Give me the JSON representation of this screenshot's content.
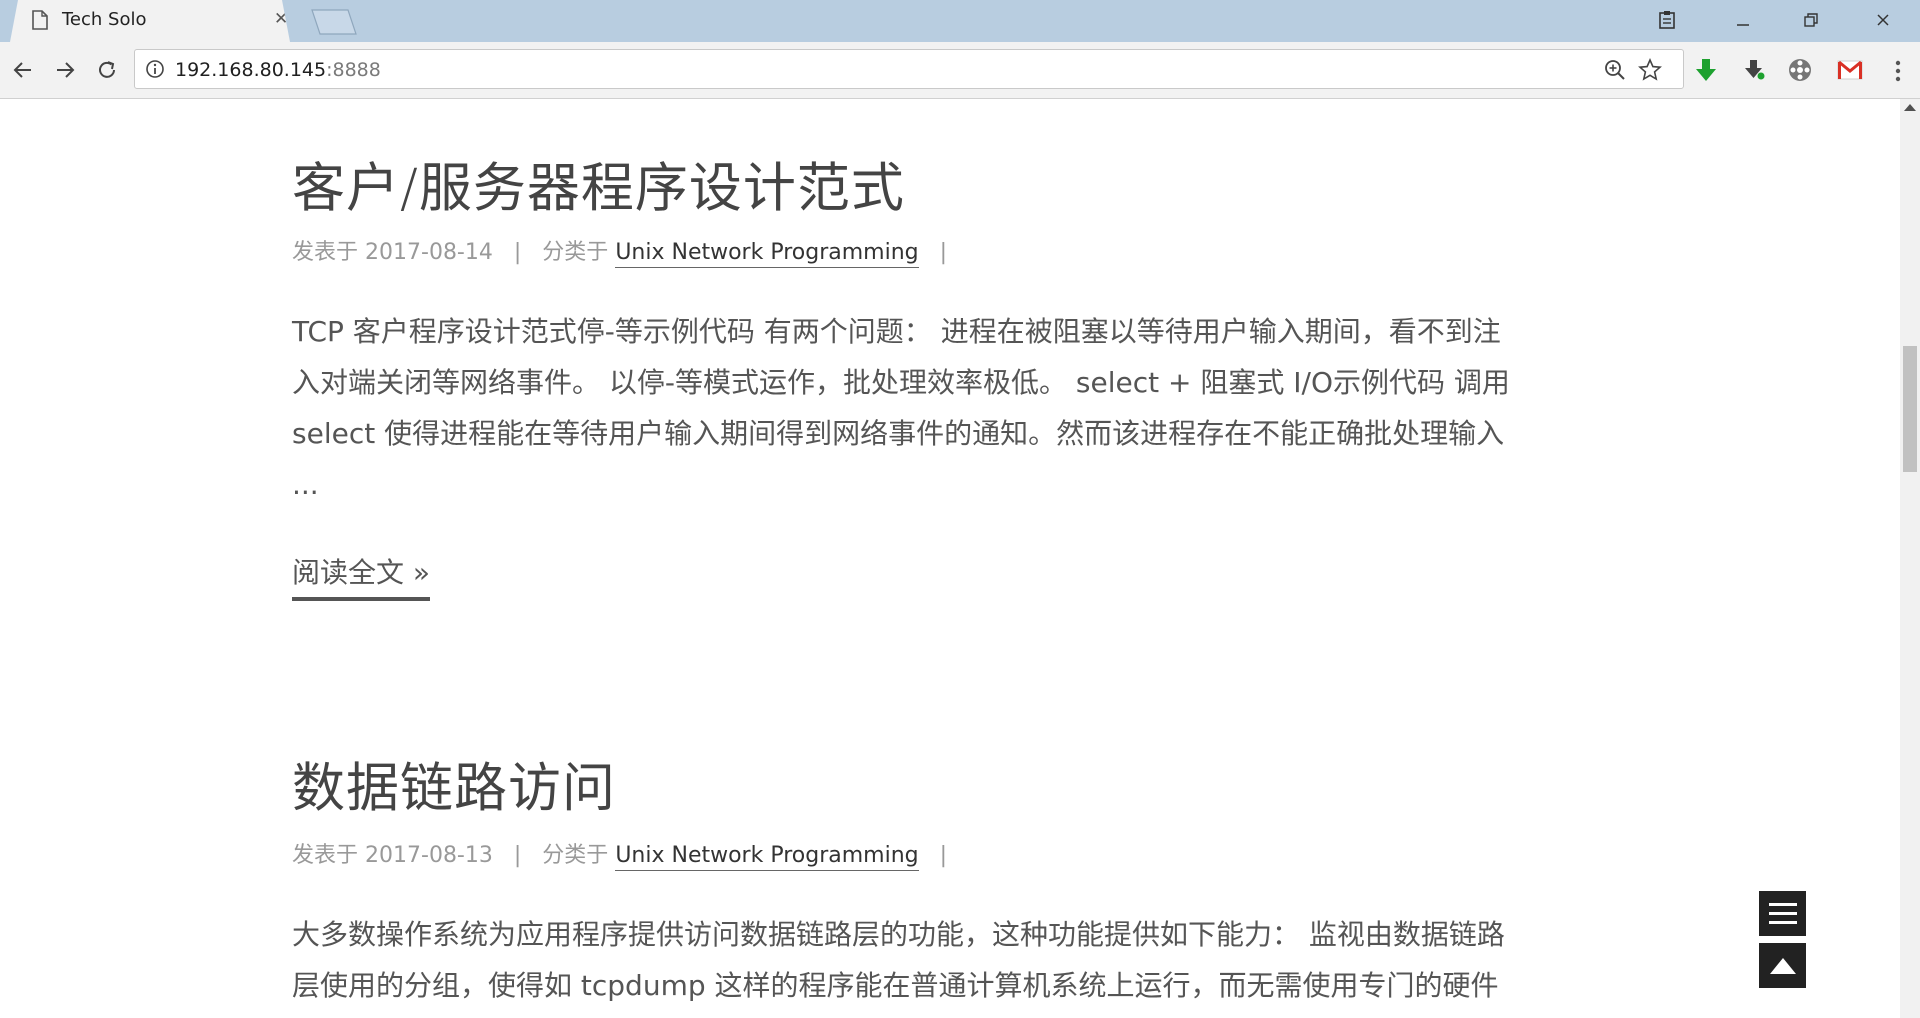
{
  "browser": {
    "tab_title": "Tech Solo",
    "url_host": "192.168.80.145",
    "url_port": ":8888"
  },
  "posts": [
    {
      "title": "客户/服务器程序设计范式",
      "date_prefix": "发表于",
      "date": "2017-08-14",
      "category_prefix": "分类于",
      "category": "Unix Network Programming",
      "excerpt_lines": [
        "TCP 客户程序设计范式停-等示例代码 有两个问题： 进程在被阻塞以等待用户输入期间，看不到注",
        "入对端关闭等网络事件。 以停-等模式运作，批处理效率极低。 select + 阻塞式 I/O示例代码 调用",
        "select 使得进程能在等待用户输入期间得到网络事件的通知。然而该进程存在不能正确批处理输入",
        "..."
      ],
      "read_more": "阅读全文 »"
    },
    {
      "title": "数据链路访问",
      "date_prefix": "发表于",
      "date": "2017-08-13",
      "category_prefix": "分类于",
      "category": "Unix Network Programming",
      "excerpt_lines": [
        "大多数操作系统为应用程序提供访问数据链路层的功能，这种功能提供如下能力： 监视由数据链路",
        "层使用的分组，使得如 tcpdump 这样的程序能在普通计算机系统上运行，而无需使用专门的硬件"
      ]
    }
  ],
  "meta_separator": "|",
  "colors": {
    "titlebar": "#b8cde0",
    "toolbar": "#f2f2f2",
    "text": "#555555",
    "float_button": "#222222"
  }
}
